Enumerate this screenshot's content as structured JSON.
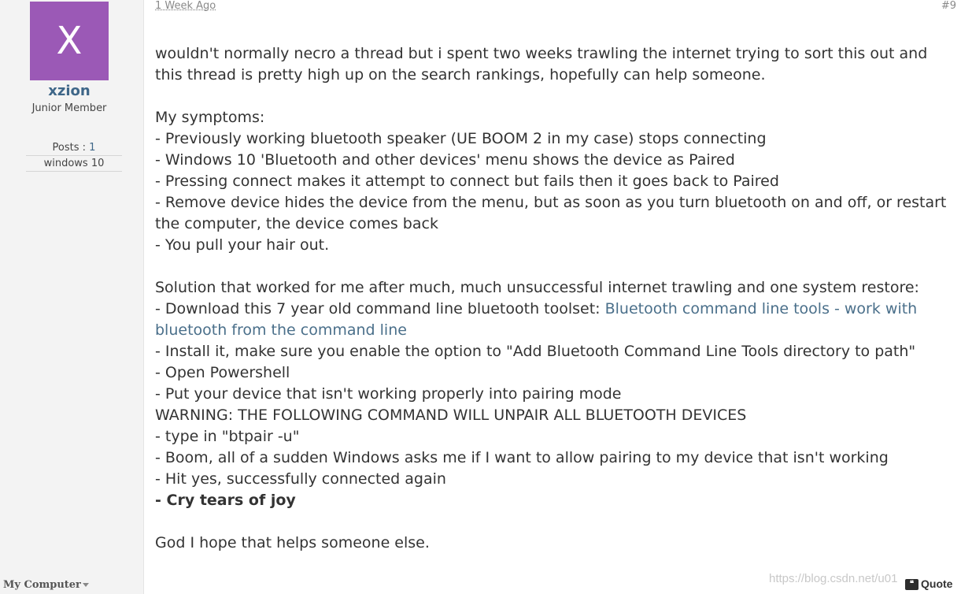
{
  "user": {
    "avatar_letter": "X",
    "avatar_color": "#9b59b6",
    "username": "xzion",
    "title": "Junior Member",
    "posts_label": "Posts : ",
    "posts_count": "1",
    "os": "windows 10",
    "my_computer": "My Computer"
  },
  "post": {
    "date": "1 Week Ago",
    "number": "#9",
    "lines": {
      "l1": "wouldn't normally necro a thread but i spent two weeks trawling the internet trying to sort this out and this thread is pretty high up on the search rankings, hopefully can help someone.",
      "l2": "My symptoms:",
      "l3": "- Previously working bluetooth speaker (UE BOOM 2 in my case) stops connecting",
      "l4": "- Windows 10 'Bluetooth and other devices' menu shows the device as Paired",
      "l5": "- Pressing connect makes it attempt to connect but fails then it goes back to Paired",
      "l6": "- Remove device hides the device from the menu, but as soon as you turn bluetooth on and off, or restart the computer, the device comes back",
      "l7": "- You pull your hair out.",
      "l8": "Solution that worked for me after much, much unsuccessful internet trawling and one system restore:",
      "l9_prefix": "- Download this 7 year old command line bluetooth toolset: ",
      "l9_link": "Bluetooth command line tools - work with bluetooth from the command line",
      "l10": "- Install it, make sure you enable the option to \"Add Bluetooth Command Line Tools directory to path\"",
      "l11": "- Open Powershell",
      "l12": "- Put your device that isn't working properly into pairing mode",
      "l13": "WARNING: THE FOLLOWING COMMAND WILL UNPAIR ALL BLUETOOTH DEVICES",
      "l14": "- type in \"btpair -u\"",
      "l15": "- Boom, all of a sudden Windows asks me if I want to allow pairing to my device that isn't working",
      "l16": "- Hit yes, successfully connected again",
      "l17": "- Cry tears of joy",
      "l18": "God I hope that helps someone else."
    },
    "quote_label": "Quote",
    "quote_icon": "quote-icon"
  },
  "watermark": "https://blog.csdn.net/u01"
}
